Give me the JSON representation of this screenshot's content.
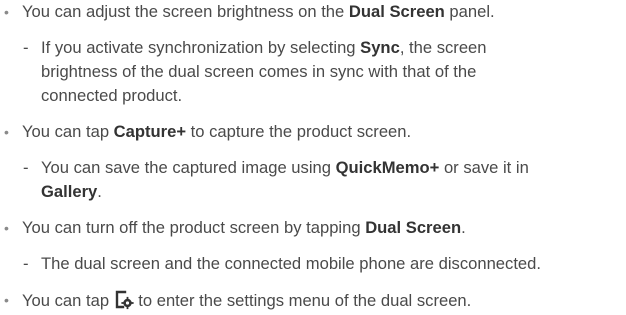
{
  "bullets": [
    {
      "text_before": "You can adjust the screen brightness on the ",
      "bold": "Dual Screen",
      "text_after": " panel.",
      "sub": {
        "line1_before": "If you activate synchronization by selecting ",
        "line1_bold": "Sync",
        "line1_after": ", the screen",
        "line2": "brightness of the dual screen comes in sync with that of the",
        "line3": "connected product."
      }
    },
    {
      "text_before": "You can tap ",
      "bold": "Capture+",
      "text_after": " to capture the product screen.",
      "sub": {
        "line1_before": "You can save the captured image using ",
        "line1_bold": "QuickMemo+",
        "line1_after": " or save it in",
        "line2_bold": "Gallery",
        "line2_after": "."
      }
    },
    {
      "text_before": "You can turn off the product screen by tapping ",
      "bold": "Dual Screen",
      "text_after": ".",
      "sub": {
        "line1": "The dual screen and the connected mobile phone are disconnected."
      }
    },
    {
      "text_before": "You can tap ",
      "icon": "settings-icon",
      "text_after": " to enter the settings menu of the dual screen."
    }
  ],
  "marks": {
    "bullet": "•",
    "dash": "-"
  }
}
